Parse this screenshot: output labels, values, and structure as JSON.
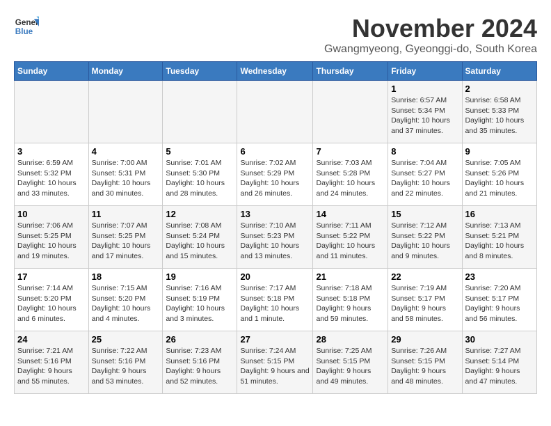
{
  "logo": {
    "name_line1": "General",
    "name_line2": "Blue"
  },
  "header": {
    "month_year": "November 2024",
    "location": "Gwangmyeong, Gyeonggi-do, South Korea"
  },
  "weekdays": [
    "Sunday",
    "Monday",
    "Tuesday",
    "Wednesday",
    "Thursday",
    "Friday",
    "Saturday"
  ],
  "weeks": [
    [
      {
        "day": "",
        "info": ""
      },
      {
        "day": "",
        "info": ""
      },
      {
        "day": "",
        "info": ""
      },
      {
        "day": "",
        "info": ""
      },
      {
        "day": "",
        "info": ""
      },
      {
        "day": "1",
        "info": "Sunrise: 6:57 AM\nSunset: 5:34 PM\nDaylight: 10 hours and 37 minutes."
      },
      {
        "day": "2",
        "info": "Sunrise: 6:58 AM\nSunset: 5:33 PM\nDaylight: 10 hours and 35 minutes."
      }
    ],
    [
      {
        "day": "3",
        "info": "Sunrise: 6:59 AM\nSunset: 5:32 PM\nDaylight: 10 hours and 33 minutes."
      },
      {
        "day": "4",
        "info": "Sunrise: 7:00 AM\nSunset: 5:31 PM\nDaylight: 10 hours and 30 minutes."
      },
      {
        "day": "5",
        "info": "Sunrise: 7:01 AM\nSunset: 5:30 PM\nDaylight: 10 hours and 28 minutes."
      },
      {
        "day": "6",
        "info": "Sunrise: 7:02 AM\nSunset: 5:29 PM\nDaylight: 10 hours and 26 minutes."
      },
      {
        "day": "7",
        "info": "Sunrise: 7:03 AM\nSunset: 5:28 PM\nDaylight: 10 hours and 24 minutes."
      },
      {
        "day": "8",
        "info": "Sunrise: 7:04 AM\nSunset: 5:27 PM\nDaylight: 10 hours and 22 minutes."
      },
      {
        "day": "9",
        "info": "Sunrise: 7:05 AM\nSunset: 5:26 PM\nDaylight: 10 hours and 21 minutes."
      }
    ],
    [
      {
        "day": "10",
        "info": "Sunrise: 7:06 AM\nSunset: 5:25 PM\nDaylight: 10 hours and 19 minutes."
      },
      {
        "day": "11",
        "info": "Sunrise: 7:07 AM\nSunset: 5:25 PM\nDaylight: 10 hours and 17 minutes."
      },
      {
        "day": "12",
        "info": "Sunrise: 7:08 AM\nSunset: 5:24 PM\nDaylight: 10 hours and 15 minutes."
      },
      {
        "day": "13",
        "info": "Sunrise: 7:10 AM\nSunset: 5:23 PM\nDaylight: 10 hours and 13 minutes."
      },
      {
        "day": "14",
        "info": "Sunrise: 7:11 AM\nSunset: 5:22 PM\nDaylight: 10 hours and 11 minutes."
      },
      {
        "day": "15",
        "info": "Sunrise: 7:12 AM\nSunset: 5:22 PM\nDaylight: 10 hours and 9 minutes."
      },
      {
        "day": "16",
        "info": "Sunrise: 7:13 AM\nSunset: 5:21 PM\nDaylight: 10 hours and 8 minutes."
      }
    ],
    [
      {
        "day": "17",
        "info": "Sunrise: 7:14 AM\nSunset: 5:20 PM\nDaylight: 10 hours and 6 minutes."
      },
      {
        "day": "18",
        "info": "Sunrise: 7:15 AM\nSunset: 5:20 PM\nDaylight: 10 hours and 4 minutes."
      },
      {
        "day": "19",
        "info": "Sunrise: 7:16 AM\nSunset: 5:19 PM\nDaylight: 10 hours and 3 minutes."
      },
      {
        "day": "20",
        "info": "Sunrise: 7:17 AM\nSunset: 5:18 PM\nDaylight: 10 hours and 1 minute."
      },
      {
        "day": "21",
        "info": "Sunrise: 7:18 AM\nSunset: 5:18 PM\nDaylight: 9 hours and 59 minutes."
      },
      {
        "day": "22",
        "info": "Sunrise: 7:19 AM\nSunset: 5:17 PM\nDaylight: 9 hours and 58 minutes."
      },
      {
        "day": "23",
        "info": "Sunrise: 7:20 AM\nSunset: 5:17 PM\nDaylight: 9 hours and 56 minutes."
      }
    ],
    [
      {
        "day": "24",
        "info": "Sunrise: 7:21 AM\nSunset: 5:16 PM\nDaylight: 9 hours and 55 minutes."
      },
      {
        "day": "25",
        "info": "Sunrise: 7:22 AM\nSunset: 5:16 PM\nDaylight: 9 hours and 53 minutes."
      },
      {
        "day": "26",
        "info": "Sunrise: 7:23 AM\nSunset: 5:16 PM\nDaylight: 9 hours and 52 minutes."
      },
      {
        "day": "27",
        "info": "Sunrise: 7:24 AM\nSunset: 5:15 PM\nDaylight: 9 hours and 51 minutes."
      },
      {
        "day": "28",
        "info": "Sunrise: 7:25 AM\nSunset: 5:15 PM\nDaylight: 9 hours and 49 minutes."
      },
      {
        "day": "29",
        "info": "Sunrise: 7:26 AM\nSunset: 5:15 PM\nDaylight: 9 hours and 48 minutes."
      },
      {
        "day": "30",
        "info": "Sunrise: 7:27 AM\nSunset: 5:14 PM\nDaylight: 9 hours and 47 minutes."
      }
    ]
  ]
}
